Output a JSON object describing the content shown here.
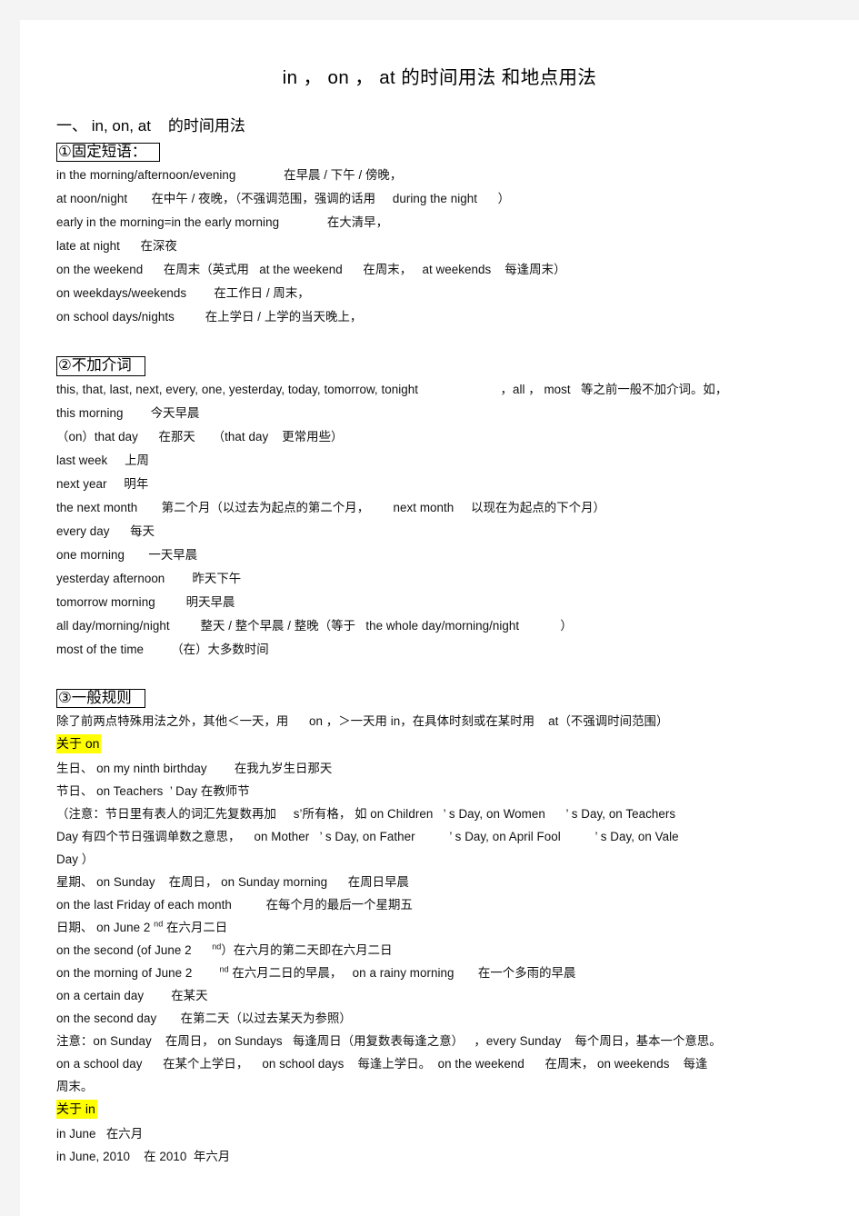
{
  "document": {
    "title": "in ， on ， at 的时间用法 和地点用法",
    "section_one_heading": "一、 in, on, at    的时间用法",
    "subsection_1": {
      "heading": "①固定短语：",
      "lines": [
        "in the morning/afternoon/evening              在早晨 / 下午 / 傍晚，",
        "at noon/night       在中午 / 夜晚，（不强调范围，强调的话用     during the night      ）",
        "early in the morning=in the early morning              在大清早，",
        "late at night      在深夜",
        "on the weekend      在周末（英式用   at the weekend      在周末，   at weekends    每逢周末）",
        "on weekdays/weekends        在工作日 / 周末，",
        "on school days/nights         在上学日 / 上学的当天晚上，"
      ]
    },
    "subsection_2": {
      "heading": "②不加介词",
      "lines": [
        "this, that, last, next, every, one, yesterday, today, tomorrow, tonight                        ，all ， most   等之前一般不加介词。如，",
        "this morning        今天早晨",
        "（on）that day      在那天     （that day    更常用些）",
        "last week     上周",
        "next year     明年",
        "the next month       第二个月（以过去为起点的第二个月，       next month     以现在为起点的下个月）",
        "every day      每天",
        "one morning       一天早晨",
        "yesterday afternoon        昨天下午",
        "tomorrow morning         明天早晨",
        "all day/morning/night         整天 / 整个早晨 / 整晚（等于   the whole day/morning/night            ）",
        "most of the time        （在）大多数时间"
      ]
    },
    "subsection_3": {
      "heading": "③一般规则",
      "intro": "除了前两点特殊用法之外，其他＜一天，用      on ，＞一天用 in，在具体时刻或在某时用    at（不强调时间范围）",
      "highlight_on": "关于 on",
      "lines_on": [
        "生日、 on my ninth birthday        在我九岁生日那天",
        "节日、 on Teachers  ’ Day 在教师节",
        "（注意：节日里有表人的词汇先复数再加     s’所有格， 如 on Children   ’ s Day, on Women      ’ s Day, on Teachers",
        "Day 有四个节日强调单数之意思，    on Mother   ’ s Day, on Father          ’ s Day, on April Fool          ’ s Day, on Vale",
        "Day ）",
        "星期、 on Sunday    在周日， on Sunday morning      在周日早晨",
        "on the last Friday of each month          在每个月的最后一个星期五"
      ],
      "line_june_2nd": {
        "pre": "日期、 on June 2 ",
        "sup": "nd",
        "post": " 在六月二日"
      },
      "line_second_of_june": {
        "pre": "on the second (of June 2      ",
        "sup": "nd",
        "post": "）在六月的第二天即在六月二日"
      },
      "line_morning_of_june": {
        "pre": "on the morning of June 2        ",
        "sup": "nd",
        "post": " 在六月二日的早晨，   on a rainy morning       在一个多雨的早晨"
      },
      "lines_on_tail": [
        "on a certain day        在某天",
        "on the second day       在第二天（以过去某天为参照）",
        "注意：on Sunday    在周日， on Sundays   每逢周日（用复数表每逢之意）   ，every Sunday    每个周日，基本一个意思。",
        "on a school day      在某个上学日，    on school days    每逢上学日。  on the weekend      在周末， on weekends    每逢",
        "周末。"
      ],
      "highlight_in": "关于 in",
      "lines_in": [
        "in June   在六月",
        "in June, 2010    在 2010  年六月"
      ]
    }
  },
  "colors": {
    "page_background": "#ffffff",
    "canvas_background": "#f4f4f4",
    "text": "#111111",
    "highlight": "#ffff00",
    "box_border": "#000000"
  }
}
